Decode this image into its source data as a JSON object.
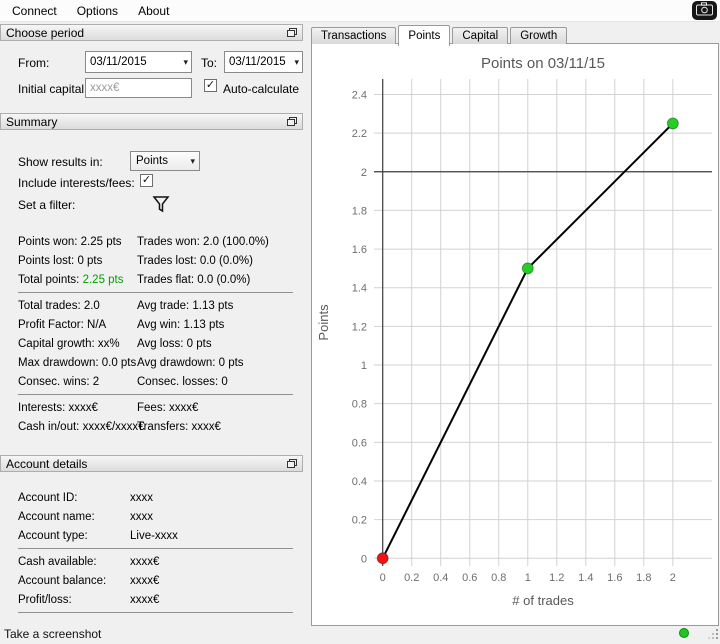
{
  "colors": {
    "accent_green": "#00a000",
    "status_dot": "#21c421",
    "chart_grid": "#d2d2d2"
  },
  "icons": {
    "dropdown_arrow": "▾",
    "checkbox_check": "✓",
    "camera": "camera-lens-on-black-square",
    "detach": "detach-window-two-rects",
    "filter": "funnel-outline"
  },
  "menu": {
    "items": [
      {
        "label": "Connect"
      },
      {
        "label": "Options"
      },
      {
        "label": "About"
      }
    ]
  },
  "choose_period": {
    "title": "Choose period",
    "from_label": "From:",
    "from_value": "03/11/2015",
    "to_label": "To:",
    "to_value": "03/11/2015",
    "initial_capital_label": "Initial capital:",
    "initial_capital_placeholder": "xxxx€",
    "auto_calculate_label": "Auto-calculate",
    "auto_calculate_checked": true
  },
  "summary": {
    "title": "Summary",
    "show_results_label": "Show results in:",
    "show_results_value": "Points",
    "include_label": "Include interests/fees:",
    "include_checked": true,
    "filter_label": "Set a filter:",
    "stats": [
      {
        "left": "Points won: 2.25 pts",
        "right": "Trades won: 2.0 (100.0%)"
      },
      {
        "left": "Points lost: 0 pts",
        "right": "Trades lost: 0.0 (0.0%)"
      },
      {
        "left_label": "Total points:",
        "left_value": "2.25 pts",
        "right": "Trades flat: 0.0 (0.0%)"
      },
      {
        "left": "Total trades: 2.0",
        "right": "Avg trade: 1.13 pts"
      },
      {
        "left": "Profit Factor: N/A",
        "right": "Avg win: 1.13 pts"
      },
      {
        "left": "Capital growth: xx%",
        "right": "Avg loss: 0 pts"
      },
      {
        "left": "Max drawdown: 0.0 pts",
        "right": "Avg drawdown: 0 pts"
      },
      {
        "left": "Consec. wins: 2",
        "right": "Consec. losses: 0"
      },
      {
        "left": "Interests: xxxx€",
        "right": "Fees: xxxx€"
      },
      {
        "left": "Cash in/out: xxxx€/xxxx€",
        "right": "Transfers: xxxx€"
      }
    ]
  },
  "account": {
    "title": "Account details",
    "rows": [
      {
        "label": "Account ID:",
        "value": "xxxx"
      },
      {
        "label": "Account name:",
        "value": "xxxx"
      },
      {
        "label": "Account type:",
        "value": "Live-xxxx"
      },
      {
        "label": "Cash available:",
        "value": "xxxx€"
      },
      {
        "label": "Account balance:",
        "value": "xxxx€"
      },
      {
        "label": "Profit/loss:",
        "value": "xxxx€"
      }
    ]
  },
  "tabs": {
    "active": "Points",
    "items": [
      {
        "label": "Transactions"
      },
      {
        "label": "Points"
      },
      {
        "label": "Capital"
      },
      {
        "label": "Growth"
      }
    ]
  },
  "footer": {
    "take_screenshot_label": "Take a screenshot"
  },
  "chart_data": {
    "type": "line",
    "title": "Points on 03/11/15",
    "xlabel": "# of trades",
    "ylabel": "Points",
    "x": [
      0,
      1,
      2
    ],
    "y": [
      0,
      1.5,
      2.25
    ],
    "point_colors": [
      "#f01515",
      "#22cf22",
      "#22cf22"
    ],
    "line_color": "#000000",
    "xlim": [
      -0.06,
      2.27
    ],
    "ylim": [
      -0.04,
      2.48
    ],
    "x_ticks": [
      0,
      0.2,
      0.4,
      0.6,
      0.8,
      1,
      1.2,
      1.4,
      1.6,
      1.8,
      2
    ],
    "y_ticks": [
      0,
      0.2,
      0.4,
      0.6,
      0.8,
      1,
      1.2,
      1.4,
      1.6,
      1.8,
      2,
      2.2,
      2.4
    ],
    "grid": true,
    "legend": false,
    "dark_reference_lines": {
      "vertical_at_x": 0,
      "horizontal_at_y": 2
    }
  }
}
